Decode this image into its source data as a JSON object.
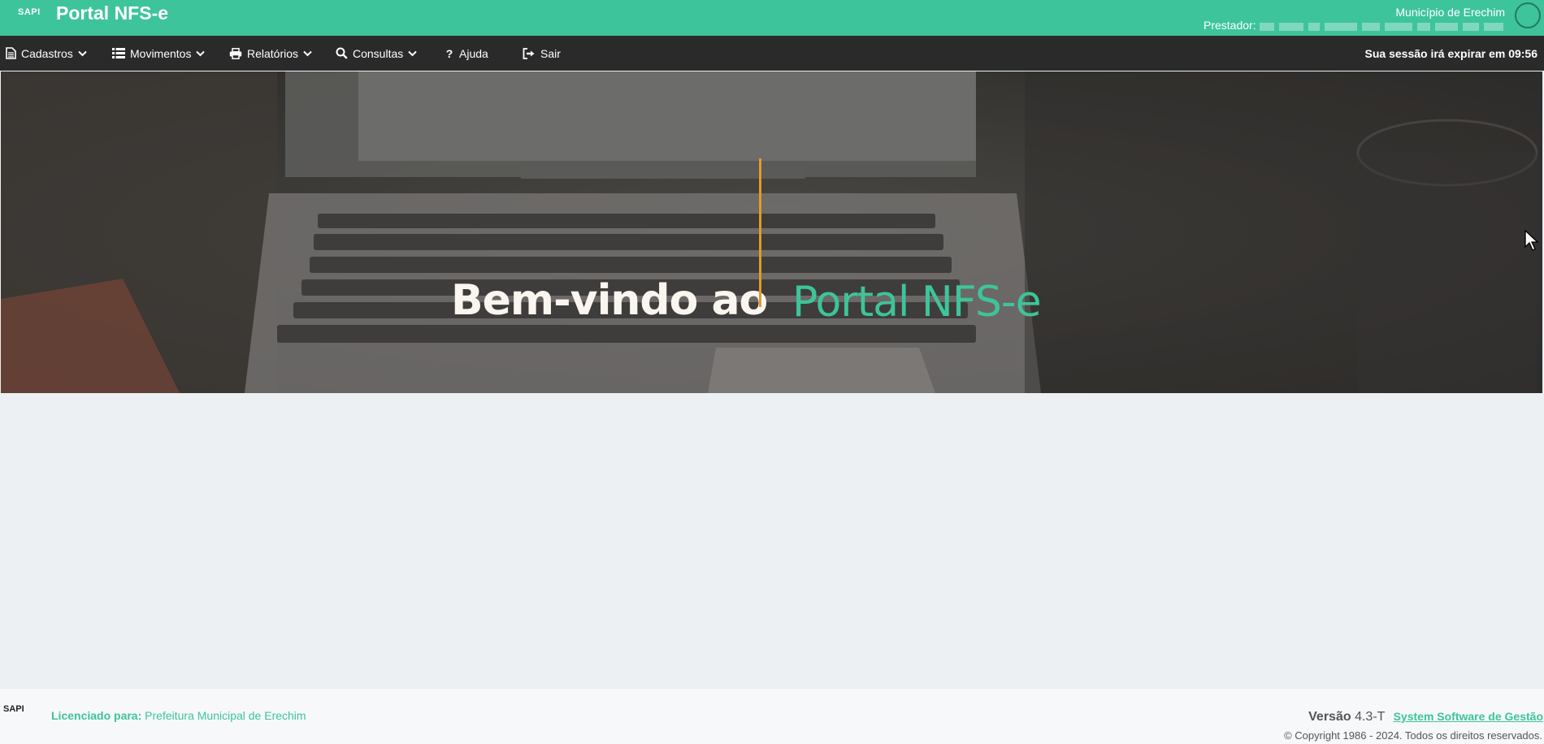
{
  "header": {
    "logo_text": "SAPI",
    "app_title": "Portal NFS-e",
    "municipio": "Município de Erechim",
    "prestador_label": "Prestador:"
  },
  "nav": {
    "items": [
      {
        "label": "Cadastros",
        "icon": "file-icon",
        "has_dropdown": true
      },
      {
        "label": "Movimentos",
        "icon": "list-icon",
        "has_dropdown": true
      },
      {
        "label": "Relatórios",
        "icon": "print-icon",
        "has_dropdown": true
      },
      {
        "label": "Consultas",
        "icon": "search-icon",
        "has_dropdown": true
      },
      {
        "label": "Ajuda",
        "icon": "question-icon",
        "has_dropdown": false
      },
      {
        "label": "Sair",
        "icon": "sign-out-icon",
        "has_dropdown": false
      }
    ],
    "session_text": "Sua sessão irá expirar em 09:56"
  },
  "banner": {
    "welcome": "Bem-vindo ao",
    "portal_name": "Portal NFS-e"
  },
  "footer": {
    "logo_text": "SAPI",
    "licensed_label": "Licenciado para:",
    "licensee": "Prefeitura Municipal de Erechim",
    "version_label": "Versão",
    "version_number": "4.3-T",
    "company_link": "System Software de Gestão",
    "copyright": "© Copyright 1986 - 2024. Todos os direitos reservados."
  },
  "colors": {
    "brand_green": "#3ec49a",
    "nav_bg": "#2a2a2a",
    "accent_orange": "#e39a29",
    "page_bg": "#ecf0f2"
  }
}
